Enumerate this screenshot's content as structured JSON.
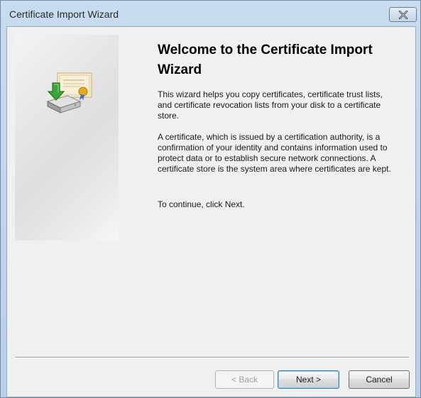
{
  "window": {
    "title": "Certificate Import Wizard",
    "close_glyph": "close-icon"
  },
  "content": {
    "heading": "Welcome to the Certificate Import Wizard",
    "paragraph1": "This wizard helps you copy certificates, certificate trust lists, and certificate revocation lists from your disk to a certificate store.",
    "paragraph2": "A certificate, which is issued by a certification authority, is a confirmation of your identity and contains information used to protect data or to establish secure network connections. A certificate store is the system area where certificates are kept.",
    "paragraph3": "To continue, click Next."
  },
  "buttons": {
    "back": "< Back",
    "next": "Next >",
    "cancel": "Cancel"
  },
  "icons": {
    "wizard_icon": "certificate-import-icon"
  },
  "colors": {
    "titlebar": "#c9dcef",
    "client_bg": "#f0f0f0",
    "arrow_green": "#3aa63a"
  }
}
